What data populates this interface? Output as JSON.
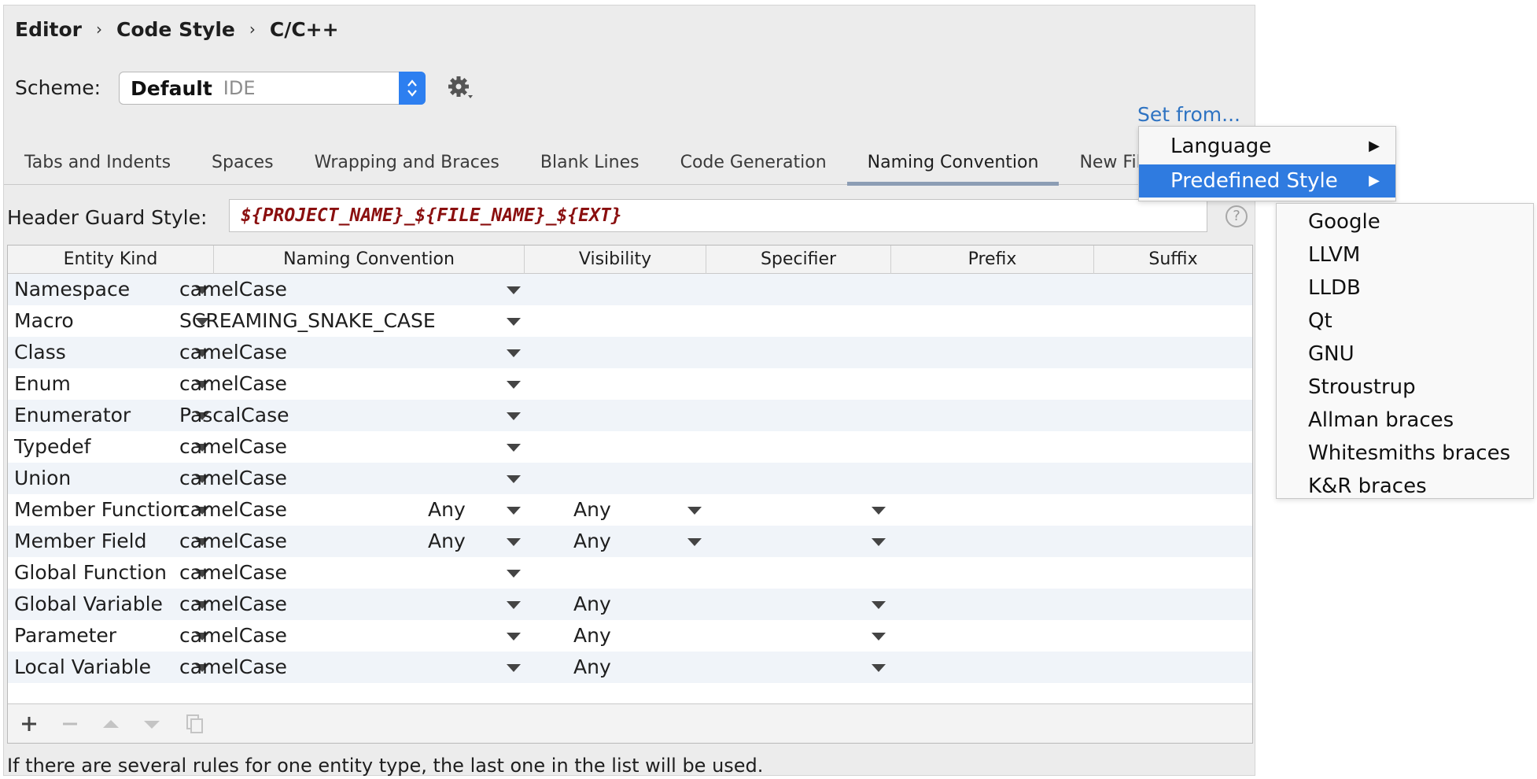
{
  "breadcrumb": [
    "Editor",
    "Code Style",
    "C/C++"
  ],
  "breadcrumb_separator": "›",
  "scheme": {
    "label": "Scheme:",
    "name": "Default",
    "type": "IDE"
  },
  "set_from": "Set from...",
  "tabs": [
    "Tabs and Indents",
    "Spaces",
    "Wrapping and Braces",
    "Blank Lines",
    "Code Generation",
    "Naming Convention",
    "New File Ext"
  ],
  "active_tab": "Naming Convention",
  "header_guard": {
    "label": "Header Guard Style:",
    "value": "${PROJECT_NAME}_${FILE_NAME}_${EXT}",
    "help": "?"
  },
  "table": {
    "columns": [
      "Entity Kind",
      "Naming Convention",
      "Visibility",
      "Specifier",
      "Prefix",
      "Suffix"
    ],
    "rows": [
      {
        "kind": "Namespace",
        "convention": "camelCase",
        "visibility": "",
        "specifier": ""
      },
      {
        "kind": "Macro",
        "convention": "SCREAMING_SNAKE_CASE",
        "visibility": "",
        "specifier": ""
      },
      {
        "kind": "Class",
        "convention": "camelCase",
        "visibility": "",
        "specifier": ""
      },
      {
        "kind": "Enum",
        "convention": "camelCase",
        "visibility": "",
        "specifier": ""
      },
      {
        "kind": "Enumerator",
        "convention": "PascalCase",
        "visibility": "",
        "specifier": ""
      },
      {
        "kind": "Typedef",
        "convention": "camelCase",
        "visibility": "",
        "specifier": ""
      },
      {
        "kind": "Union",
        "convention": "camelCase",
        "visibility": "",
        "specifier": ""
      },
      {
        "kind": "Member Function",
        "convention": "camelCase",
        "visibility": "Any",
        "specifier": "Any"
      },
      {
        "kind": "Member Field",
        "convention": "camelCase",
        "visibility": "Any",
        "specifier": "Any"
      },
      {
        "kind": "Global Function",
        "convention": "camelCase",
        "visibility": "",
        "specifier": ""
      },
      {
        "kind": "Global Variable",
        "convention": "camelCase",
        "visibility": "",
        "specifier": "Any"
      },
      {
        "kind": "Parameter",
        "convention": "camelCase",
        "visibility": "",
        "specifier": "Any"
      },
      {
        "kind": "Local Variable",
        "convention": "camelCase",
        "visibility": "",
        "specifier": "Any"
      }
    ]
  },
  "footer_note": "If there are several rules for one entity type, the last one in the list will be used.",
  "menu": {
    "items": [
      {
        "label": "Language",
        "arrow": "▶"
      },
      {
        "label": "Predefined Style",
        "arrow": "▶"
      }
    ],
    "selected": "Predefined Style",
    "submenu": [
      "Google",
      "LLVM",
      "LLDB",
      "Qt",
      "GNU",
      "Stroustrup",
      "Allman braces",
      "Whitesmiths braces",
      "K&R braces"
    ]
  },
  "colors": {
    "accent": "#2f7be0",
    "link": "#2e73c2",
    "header_guard_text": "#8a0f0f"
  },
  "icons": [
    "gear-icon",
    "help-icon",
    "add-icon",
    "remove-icon",
    "move-up-icon",
    "move-down-icon",
    "copy-icon",
    "chevron-right-icon",
    "dropdown-arrow-icon"
  ]
}
